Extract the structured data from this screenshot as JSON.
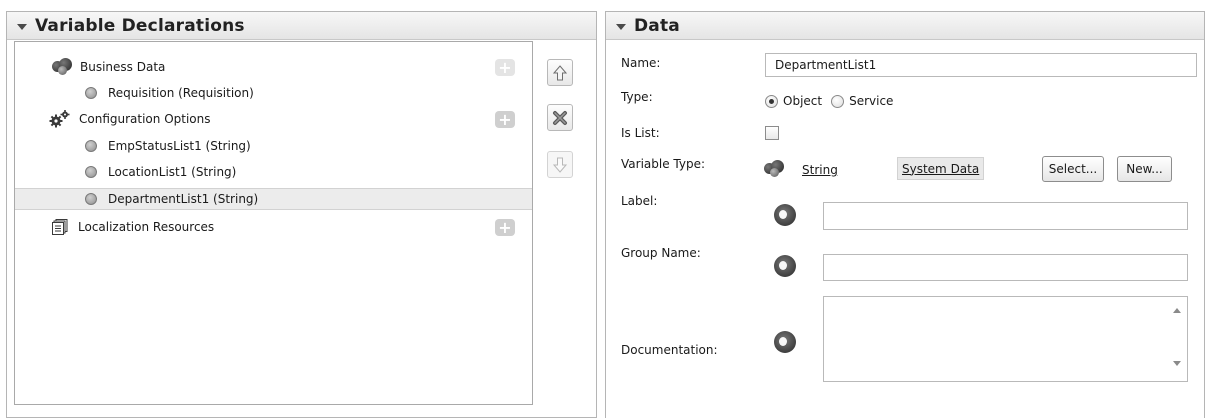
{
  "variable_declarations": {
    "title": "Variable Declarations",
    "tree": [
      {
        "label": "Business Data",
        "icon": "business-data-icon",
        "level": 0,
        "add": "plus-icon"
      },
      {
        "label": "Requisition (Requisition)",
        "icon": "variable-bullet-icon",
        "level": 1
      },
      {
        "label": "Configuration Options",
        "icon": "configuration-gears-icon",
        "level": 0,
        "add": "plus-icon"
      },
      {
        "label": "EmpStatusList1 (String)",
        "icon": "variable-bullet-icon",
        "level": 1
      },
      {
        "label": "LocationList1 (String)",
        "icon": "variable-bullet-icon",
        "level": 1
      },
      {
        "label": "DepartmentList1 (String)",
        "icon": "variable-bullet-icon",
        "level": 1,
        "selected": true
      },
      {
        "label": "Localization Resources",
        "icon": "localization-resources-icon",
        "level": 0,
        "add": "plus-icon"
      }
    ],
    "side_buttons": {
      "move_up": "arrow-up-icon",
      "delete": "delete-x-icon",
      "move_down": "arrow-down-icon"
    }
  },
  "data_panel": {
    "title": "Data",
    "name_label": "Name:",
    "name_value": "DepartmentList1",
    "type_label": "Type:",
    "type_object": "Object",
    "type_service": "Service",
    "type_selected": "Object",
    "is_list_label": "Is List:",
    "is_list_checked": false,
    "variable_type_label": "Variable Type:",
    "variable_type_value": "String",
    "system_data": "System Data",
    "select_button": "Select...",
    "new_button": "New...",
    "label_label": "Label:",
    "label_value": "",
    "group_name_label": "Group Name:",
    "group_name_value": "",
    "documentation_label": "Documentation:",
    "documentation_value": ""
  }
}
